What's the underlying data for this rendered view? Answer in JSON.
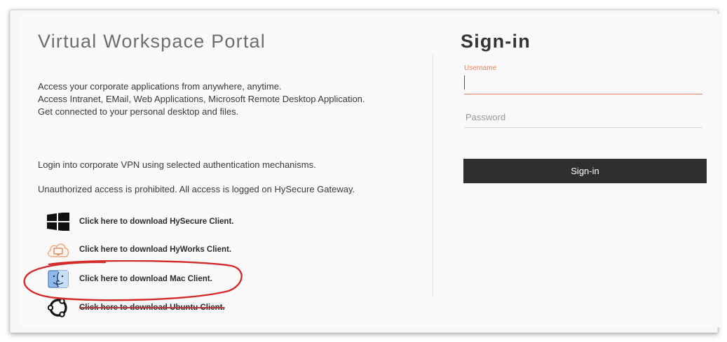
{
  "portal": {
    "title": "Virtual Workspace Portal",
    "description_lines": [
      "Access your corporate applications from anywhere, anytime.",
      "Access Intranet, EMail, Web Applications, Microsoft Remote Desktop Application.",
      "Get connected to your personal desktop and files."
    ],
    "vpn_note": "Login into corporate VPN using selected authentication mechanisms.",
    "warning": "Unauthorized access is prohibited. All access is logged on HySecure Gateway.",
    "downloads": [
      {
        "label": "Click here to download HySecure Client.",
        "icon": "windows-icon"
      },
      {
        "label": "Click here to download HyWorks Client.",
        "icon": "hyworks-cloud-icon"
      },
      {
        "label": "Click here to download Mac Client.",
        "icon": "mac-finder-icon"
      },
      {
        "label": "Click here to download Ubuntu Client.",
        "icon": "ubuntu-icon"
      }
    ]
  },
  "signin": {
    "title": "Sign-in",
    "username_label": "Username",
    "username_value": "",
    "password_placeholder": "Password",
    "button_label": "Sign-in"
  },
  "colors": {
    "accent": "#e8825c",
    "button_bg": "#2f2f2f",
    "annotation": "#d42a2a"
  }
}
